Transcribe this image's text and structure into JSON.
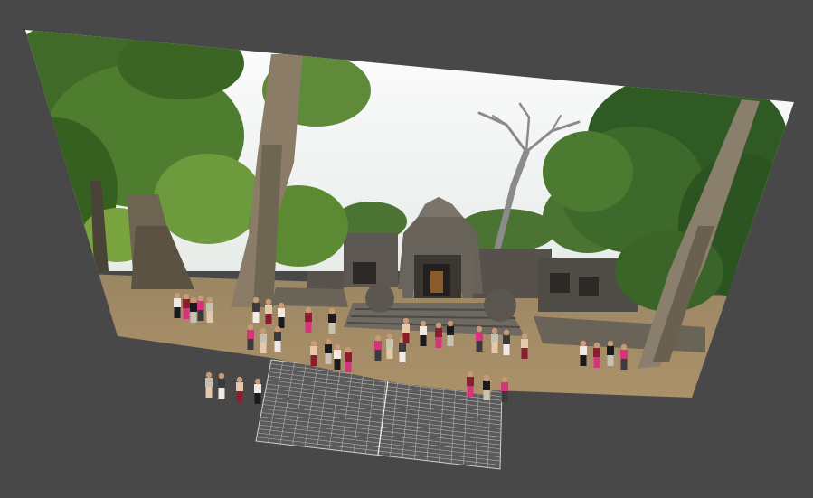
{
  "viewport": {
    "background_color": "#484848",
    "scene_subject": "temple",
    "sky_color": "#f1f3f2",
    "foliage_colors": [
      "#2f5a24",
      "#4d7c2c",
      "#6f9a3a",
      "#8bb040"
    ],
    "stone_color": "#5a5650",
    "ground_color": "#a68c66",
    "grid_color": "#cfcfcf",
    "grid_fill": "#5a5a5a",
    "figure_colors": [
      "#f2e9e4",
      "#8b1d2c",
      "#1a1a1a",
      "#d6337f",
      "#c7c2b0",
      "#3b3b3b",
      "#e6c9a8"
    ]
  }
}
